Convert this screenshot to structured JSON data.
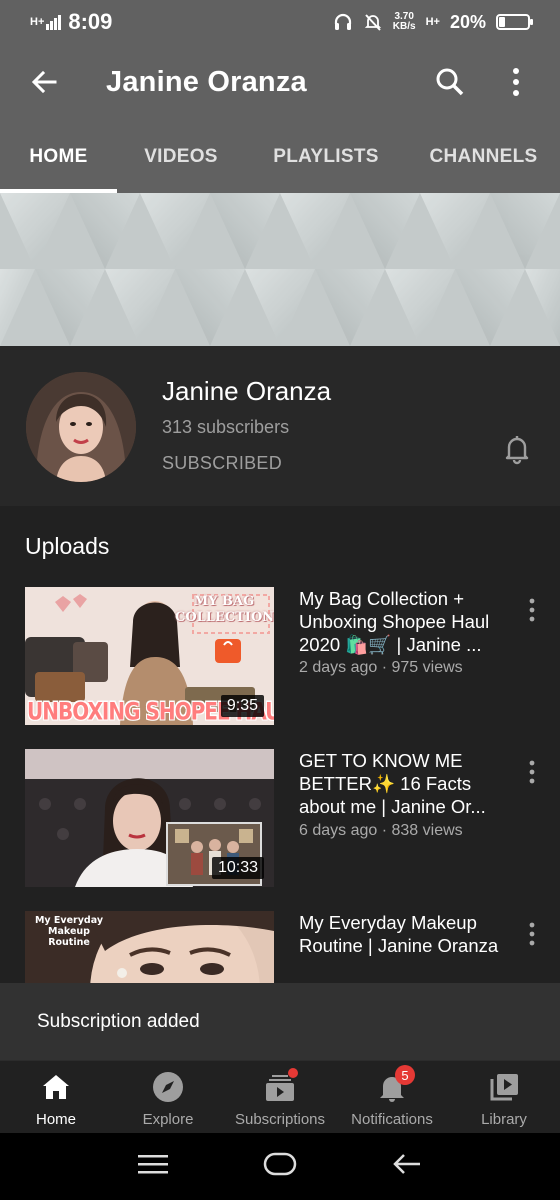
{
  "status_bar": {
    "time": "8:09",
    "network_left": "H+",
    "speed_value": "3.70",
    "speed_unit": "KB/s",
    "network_right": "H+",
    "battery": "20%",
    "battery_level": 0.2
  },
  "app_bar": {
    "title": "Janine Oranza"
  },
  "tabs": [
    {
      "label": "HOME",
      "active": true
    },
    {
      "label": "VIDEOS",
      "active": false
    },
    {
      "label": "PLAYLISTS",
      "active": false
    },
    {
      "label": "CHANNELS",
      "active": false
    }
  ],
  "channel": {
    "name": "Janine Oranza",
    "subscribers": "313 subscribers",
    "subscribe_state": "SUBSCRIBED"
  },
  "uploads": {
    "title": "Uploads",
    "videos": [
      {
        "title": "My Bag Collection + Unboxing Shopee Haul 2020 🛍️🛒 | Janine ...",
        "meta": "2 days ago · 975 views",
        "duration": "9:35",
        "thumb_text_top": "MY BAG COLLECTION",
        "thumb_text_bottom": "UNBOXING SHOPEE HAUL"
      },
      {
        "title": "GET TO KNOW ME BETTER✨ 16 Facts about me | Janine Or...",
        "meta": "6 days ago · 838 views",
        "duration": "10:33"
      },
      {
        "title": "My Everyday Makeup Routine | Janine Oranza",
        "meta": "",
        "duration": "",
        "thumb_text_top": "My Everyday Makeup Routine"
      }
    ]
  },
  "snackbar": {
    "text": "Subscription added"
  },
  "bottom_nav": [
    {
      "label": "Home",
      "icon": "home-icon",
      "active": true
    },
    {
      "label": "Explore",
      "icon": "compass-icon",
      "active": false
    },
    {
      "label": "Subscriptions",
      "icon": "subscriptions-icon",
      "active": false
    },
    {
      "label": "Notifications",
      "icon": "bell-icon",
      "active": false,
      "badge": "5"
    },
    {
      "label": "Library",
      "icon": "library-icon",
      "active": false
    }
  ],
  "colors": {
    "app_bar": "#616161",
    "background": "#212121",
    "badge": "#e53935"
  }
}
